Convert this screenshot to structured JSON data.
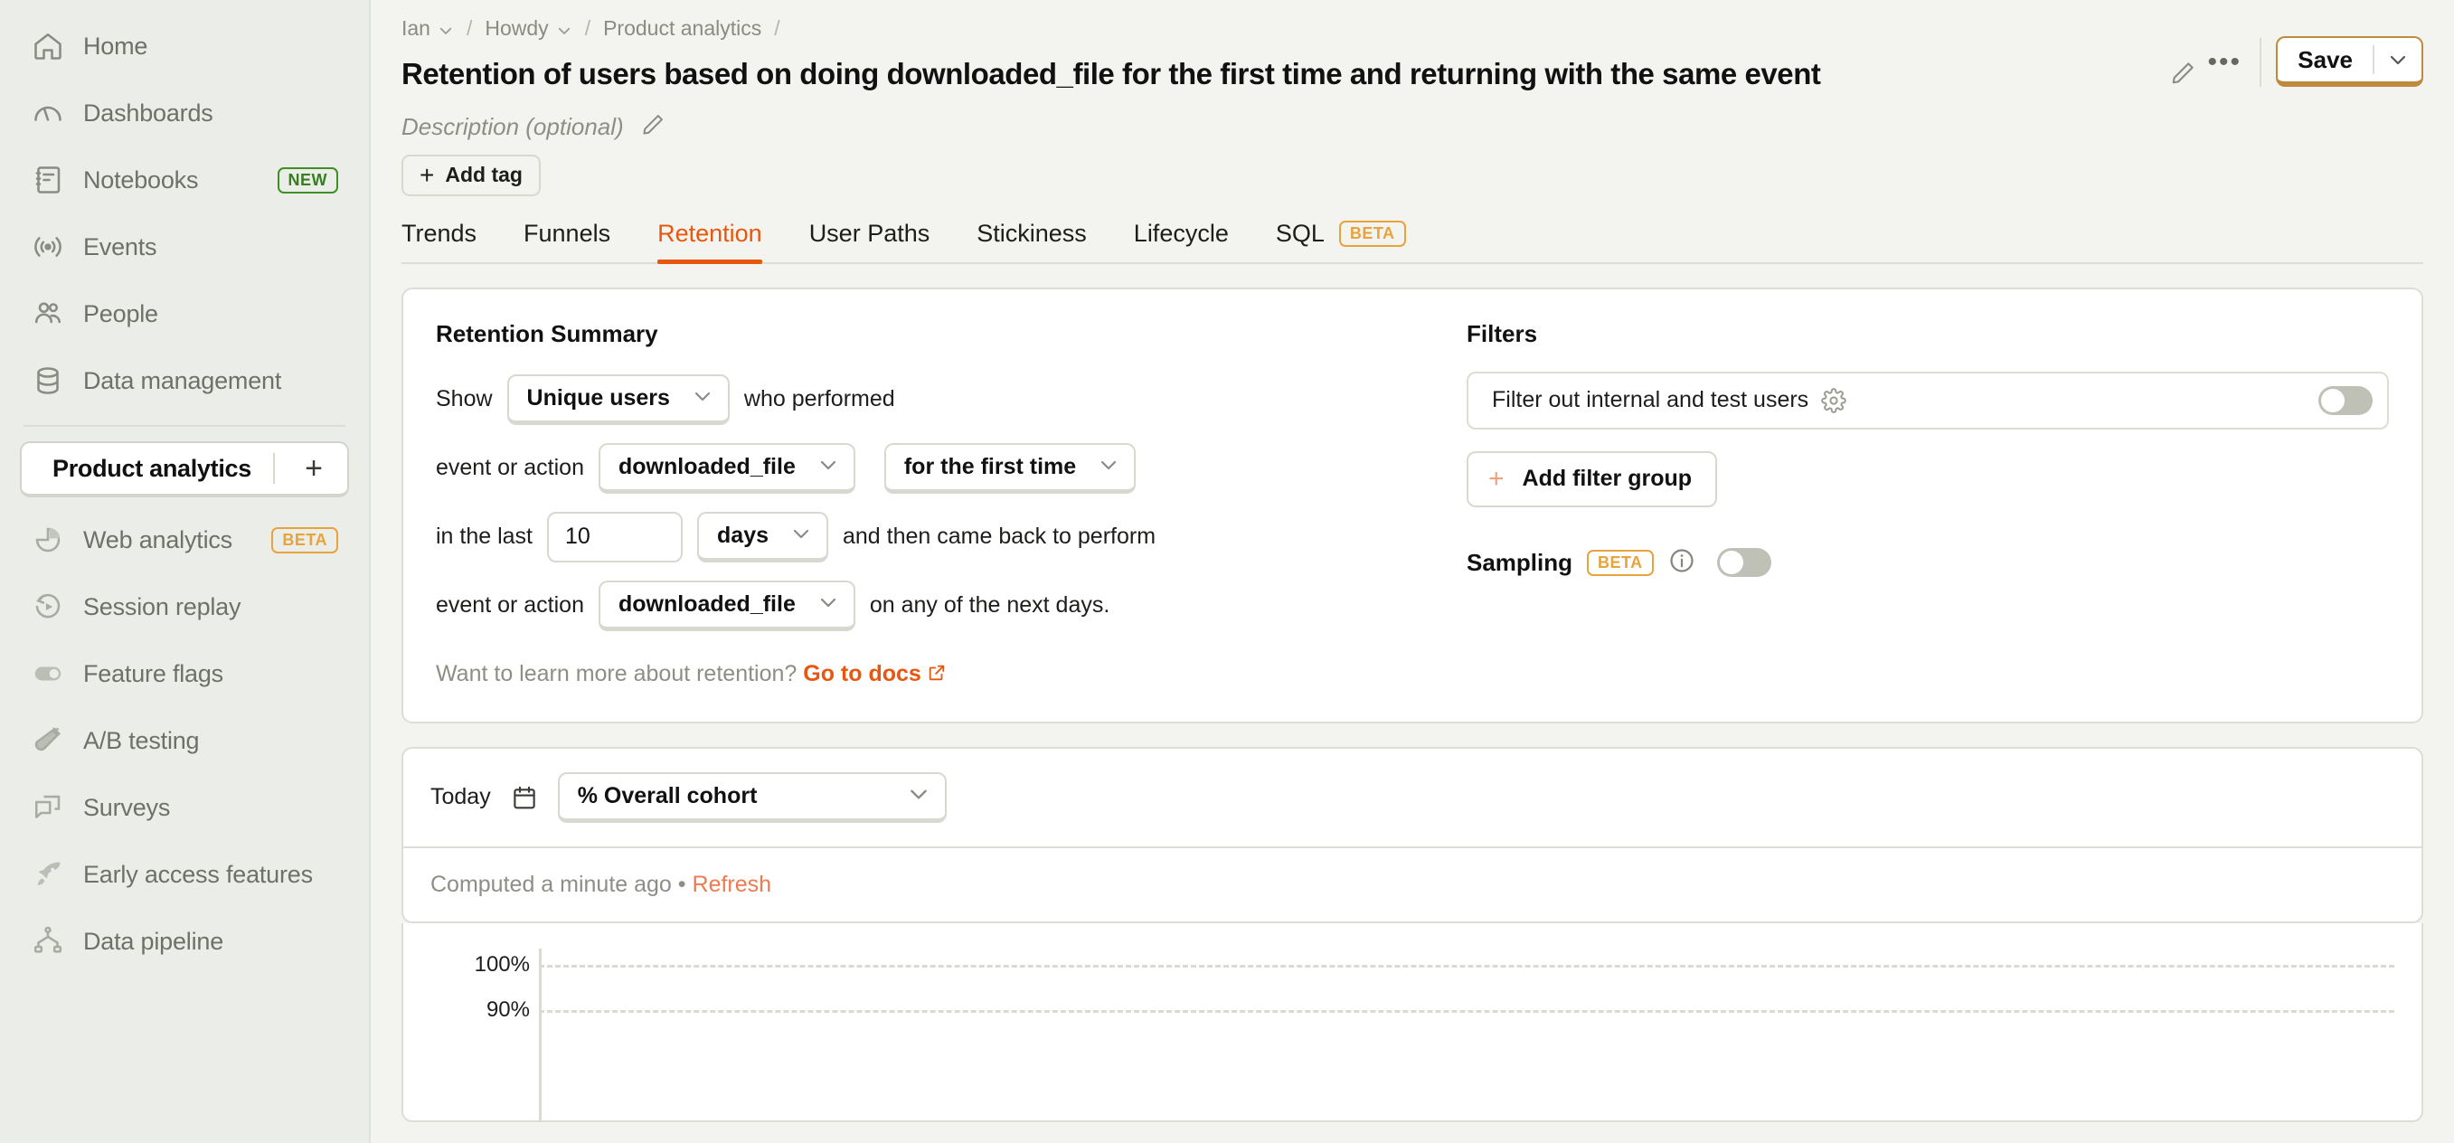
{
  "sidebar": {
    "items": [
      {
        "label": "Home",
        "icon": "home-icon",
        "badge": null
      },
      {
        "label": "Dashboards",
        "icon": "dashboard-gauge-icon",
        "badge": null
      },
      {
        "label": "Notebooks",
        "icon": "notebook-icon",
        "badge": "NEW",
        "badge_kind": "new"
      },
      {
        "label": "Events",
        "icon": "events-broadcast-icon",
        "badge": null
      },
      {
        "label": "People",
        "icon": "people-icon",
        "badge": null
      },
      {
        "label": "Data management",
        "icon": "database-icon",
        "badge": null
      }
    ],
    "project": {
      "label": "Product analytics",
      "icon": "bar-chart-icon",
      "add_label": "+"
    },
    "items2": [
      {
        "label": "Web analytics",
        "icon": "pie-chart-icon",
        "badge": "BETA",
        "badge_kind": "beta"
      },
      {
        "label": "Session replay",
        "icon": "session-replay-icon",
        "badge": null
      },
      {
        "label": "Feature flags",
        "icon": "toggle-icon",
        "badge": null
      },
      {
        "label": "A/B testing",
        "icon": "flask-icon",
        "badge": null
      },
      {
        "label": "Surveys",
        "icon": "chat-bubbles-icon",
        "badge": null
      },
      {
        "label": "Early access features",
        "icon": "rocket-icon",
        "badge": null
      },
      {
        "label": "Data pipeline",
        "icon": "pipeline-icon",
        "badge": null
      }
    ]
  },
  "header": {
    "breadcrumbs": [
      {
        "label": "Ian",
        "has_chevron": true
      },
      {
        "label": "Howdy",
        "has_chevron": true
      },
      {
        "label": "Product analytics",
        "has_chevron": false
      }
    ],
    "breadcrumb_separator": "/",
    "title": "Retention of users based on doing downloaded_file for the first time and returning with the same event",
    "title_edit_icon": "pencil-icon",
    "more_icon": "ellipsis-icon",
    "save_label": "Save",
    "save_caret_icon": "chevron-down-icon",
    "save_border_color": "#C08A3E"
  },
  "description": {
    "placeholder": "Description (optional)",
    "edit_icon": "pencil-icon",
    "add_tag_label": "Add tag",
    "add_tag_icon": "plus-icon"
  },
  "tabs": [
    {
      "label": "Trends",
      "active": false,
      "badge": null
    },
    {
      "label": "Funnels",
      "active": false,
      "badge": null
    },
    {
      "label": "Retention",
      "active": true,
      "badge": null
    },
    {
      "label": "User Paths",
      "active": false,
      "badge": null
    },
    {
      "label": "Stickiness",
      "active": false,
      "badge": null
    },
    {
      "label": "Lifecycle",
      "active": false,
      "badge": null
    },
    {
      "label": "SQL",
      "active": false,
      "badge": "BETA"
    }
  ],
  "retention_summary": {
    "title": "Retention Summary",
    "show_label": "Show",
    "show_value": "Unique users",
    "who_performed_label": "who performed",
    "event_label_1": "event or action",
    "event_value_1": "downloaded_file",
    "occurrence_value": "for the first time",
    "in_the_last_label": "in the last",
    "period_amount": "10",
    "period_unit": "days",
    "came_back_label": "and then came back to perform",
    "event_label_2": "event or action",
    "event_value_2": "downloaded_file",
    "next_days_label": "on any of the next days.",
    "docs_prefix": "Want to learn more about retention?",
    "docs_link": "Go to docs"
  },
  "filters": {
    "title": "Filters",
    "internal_label": "Filter out internal and test users",
    "internal_gear_icon": "gear-icon",
    "internal_toggle_on": false,
    "add_filter_group_label": "Add filter group",
    "sampling_label": "Sampling",
    "sampling_badge": "BETA",
    "sampling_info_icon": "info-icon",
    "sampling_toggle_on": false
  },
  "results": {
    "date_label": "Today",
    "calendar_icon": "calendar-icon",
    "breakdown_value": "% Overall cohort",
    "computed_text": "Computed a minute ago",
    "computed_separator": "•",
    "refresh_label": "Refresh"
  },
  "chart_data": {
    "type": "line",
    "title": "",
    "xlabel": "",
    "ylabel": "",
    "yticks": [
      "100%",
      "90%"
    ],
    "ytick_values": [
      100,
      90
    ],
    "ylim": [
      0,
      100
    ],
    "grid": true,
    "series": [],
    "note": "Chart is cut off at the bottom of the viewport; only the 100% and 90% gridlines are visible."
  },
  "colors": {
    "accent": "#E8570F",
    "sidebar_bg": "#EBEDE8",
    "main_bg": "#F3F4EF",
    "card_bg": "#FFFFFF",
    "border": "#DCDED6",
    "muted_text": "#8D8E86",
    "beta": "#E8A33D",
    "new": "#357F1E",
    "save_border": "#C08A3E"
  }
}
